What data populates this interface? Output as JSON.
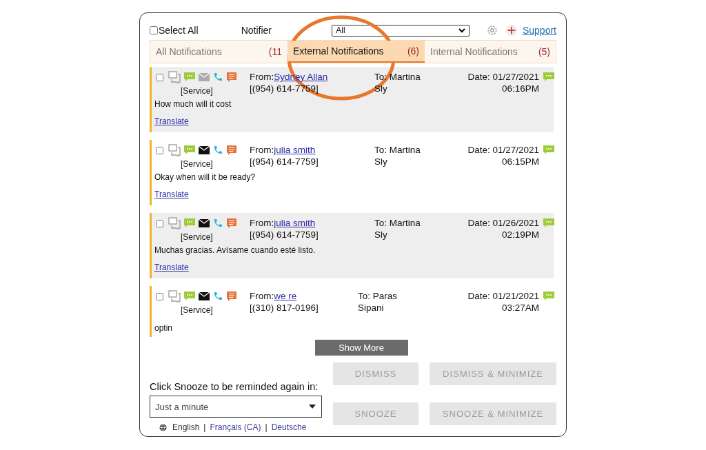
{
  "header": {
    "select_all": {
      "label": "Select All",
      "checked": false
    },
    "notifier_label": "Notifier",
    "notifier_select": "All",
    "support": "Support"
  },
  "tabs": [
    {
      "label": "All Notifications",
      "count": "(11",
      "selected": false
    },
    {
      "label": "External Notifications",
      "count": "(6)",
      "selected": true
    },
    {
      "label": "Internal Notifications",
      "count": "(5)",
      "selected": false
    }
  ],
  "notifications": [
    {
      "checked": false,
      "email_sent": false,
      "category": "[Service]",
      "message": "How much will it cost",
      "translate": "Translate",
      "from_label": "From:",
      "from_name": "Sydney Allan",
      "phone": "[(954) 614-7759]",
      "to": "To: Martina Sly",
      "date": "Date: 01/27/2021",
      "time": "06:16PM"
    },
    {
      "checked": false,
      "email_sent": true,
      "category": "[Service]",
      "message": "Okay when will it be ready?",
      "translate": "Translate",
      "from_label": "From:",
      "from_name": "julia smith",
      "phone": "[(954) 614-7759]",
      "to": "To: Martina Sly",
      "date": "Date: 01/27/2021",
      "time": "06:15PM"
    },
    {
      "checked": false,
      "email_sent": true,
      "category": "[Service]",
      "message": "Muchas gracias. Avísame cuando esté listo.",
      "translate": "Translate",
      "from_label": "From:",
      "from_name": "julia smith",
      "phone": "[(954) 614-7759]",
      "to": "To: Martina Sly",
      "date": "Date: 01/26/2021",
      "time": "02:19PM"
    },
    {
      "checked": false,
      "email_sent": true,
      "category": "[Service]",
      "message": "optin",
      "from_label": "From:",
      "from_name": "we re",
      "phone": "[(310) 817-0196]",
      "to": "To: Paras Sipani",
      "date": "Date: 01/21/2021",
      "time": "03:27AM"
    }
  ],
  "show_more": "Show More",
  "snooze": {
    "label": "Click Snooze to be reminded again in:",
    "select": "Just a minute"
  },
  "actions": [
    {
      "label": "DISMISS",
      "disabled": true
    },
    {
      "label": "DISMISS & MINIMIZE",
      "disabled": true
    },
    {
      "label": "SNOOZE",
      "disabled": true
    },
    {
      "label": "SNOOZE & MINIMIZE",
      "disabled": true
    }
  ],
  "language_separator": "|",
  "languages": [
    {
      "label": "English",
      "selected": true
    },
    {
      "label": "Français (CA)",
      "selected": false
    },
    {
      "label": "Deutsche",
      "selected": false
    }
  ]
}
